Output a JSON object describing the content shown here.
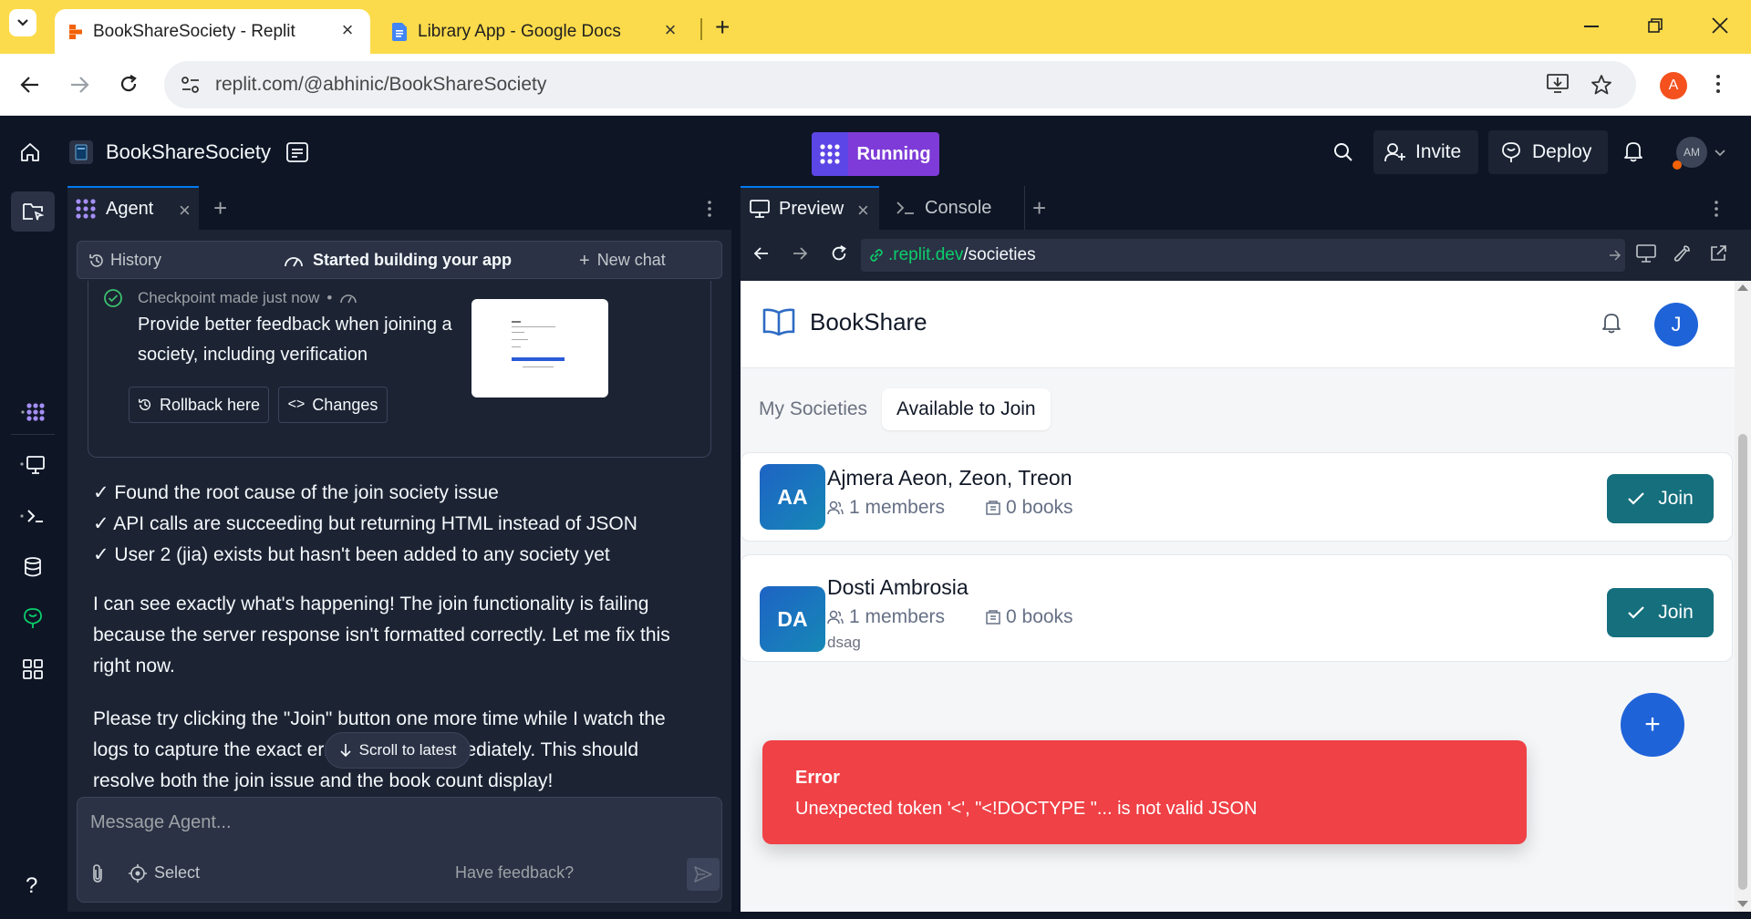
{
  "browser": {
    "tabs": [
      {
        "title": "BookShareSociety - Replit"
      },
      {
        "title": "Library App - Google Docs"
      }
    ],
    "url": "replit.com/@abhinic/BookShareSociety",
    "profile_initial": "A"
  },
  "replit": {
    "project_name": "BookShareSociety",
    "run_status": "Running",
    "invite_label": "Invite",
    "deploy_label": "Deploy",
    "user_initials": "AM",
    "help_label": "?",
    "colors": {
      "run_purple": "#7e3bd8",
      "run_icon": "#5c46e6",
      "accent_green": "#0cce6b"
    }
  },
  "agent": {
    "tab_label": "Agent",
    "history_label": "History",
    "status_label": "Started building your app",
    "new_chat_label": "New chat",
    "checkpoint": {
      "label": "Checkpoint made just now",
      "separator": "•",
      "description": "Provide better feedback when joining a society, including verification",
      "rollback_label": "Rollback here",
      "changes_label": "Changes"
    },
    "checks": [
      "✓ Found the root cause of the join society issue",
      "✓ API calls are succeeding but returning HTML instead of JSON",
      "✓ User 2 (jia) exists but hasn't been added to any society yet"
    ],
    "para1": "I can see exactly what's happening! The join functionality is failing because the server response isn't formatted correctly. Let me fix this right now.",
    "para2": "Please try clicking the \"Join\" button one more time while I watch the logs to capture the exact error and fix it immediately. This should resolve both the join issue and the book count display!",
    "scroll_latest": "Scroll to latest",
    "input_placeholder": "Message Agent...",
    "select_label": "Select",
    "feedback_label": "Have feedback?"
  },
  "preview": {
    "tabs": [
      {
        "label": "Preview"
      },
      {
        "label": "Console"
      }
    ],
    "url_domain": ".replit.dev",
    "url_path": "/societies"
  },
  "bookshare": {
    "brand": "BookShare",
    "user_initial": "J",
    "tabs": [
      {
        "label": "My Societies",
        "active": false
      },
      {
        "label": "Available to Join",
        "active": true
      }
    ],
    "societies": [
      {
        "initials": "AA",
        "name": "Ajmera Aeon, Zeon, Treon",
        "members": "1 members",
        "books": "0 books",
        "description": "",
        "join_label": "Join"
      },
      {
        "initials": "DA",
        "name": "Dosti Ambrosia",
        "members": "1 members",
        "books": "0 books",
        "description": "dsag",
        "join_label": "Join"
      }
    ],
    "fab_label": "+",
    "error": {
      "title": "Error",
      "message": "Unexpected token '<', \"<!DOCTYPE \"... is not valid JSON"
    },
    "colors": {
      "join": "#156f7d",
      "error": "#ef4146",
      "fab": "#1f63d9",
      "brand_icon": "#2d6bc4"
    }
  }
}
